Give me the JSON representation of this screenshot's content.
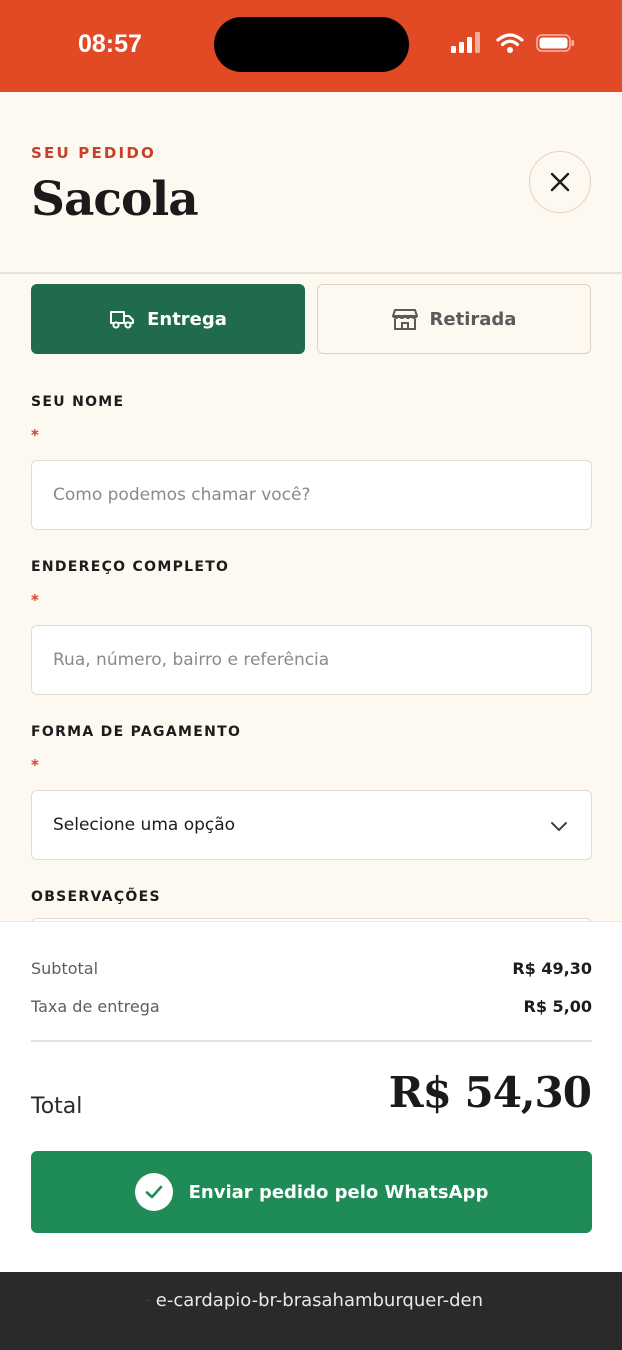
{
  "status_bar": {
    "time": "08:57"
  },
  "header": {
    "eyebrow": "SEU PEDIDO",
    "title": "Sacola"
  },
  "tabs": [
    {
      "label": "Entrega",
      "active": true,
      "icon": "truck-icon"
    },
    {
      "label": "Retirada",
      "active": false,
      "icon": "store-icon"
    }
  ],
  "form": {
    "name": {
      "label": "SEU NOME",
      "required_mark": "*",
      "placeholder": "Como podemos chamar você?"
    },
    "address": {
      "label": "ENDEREÇO COMPLETO",
      "required_mark": "*",
      "placeholder": "Rua, número, bairro e referência"
    },
    "payment": {
      "label": "FORMA DE PAGAMENTO",
      "required_mark": "*",
      "selected": "Selecione uma opção"
    },
    "notes": {
      "label": "OBSERVAÇÕES"
    }
  },
  "summary": {
    "subtotal_label": "Subtotal",
    "subtotal_value": "R$ 49,30",
    "delivery_label": "Taxa de entrega",
    "delivery_value": "R$ 5,00",
    "total_label": "Total",
    "total_value": "R$ 54,30"
  },
  "cta": {
    "label": "Enviar pedido pelo WhatsApp"
  },
  "browser": {
    "url": "e-cardapio-br-brasahamburquer-den"
  },
  "colors": {
    "status_bar": "#e24a26",
    "accent_red": "#c6402a",
    "primary_green": "#1f6b4c",
    "whatsapp_green": "#1f8c58",
    "background": "#fdf8f0"
  }
}
